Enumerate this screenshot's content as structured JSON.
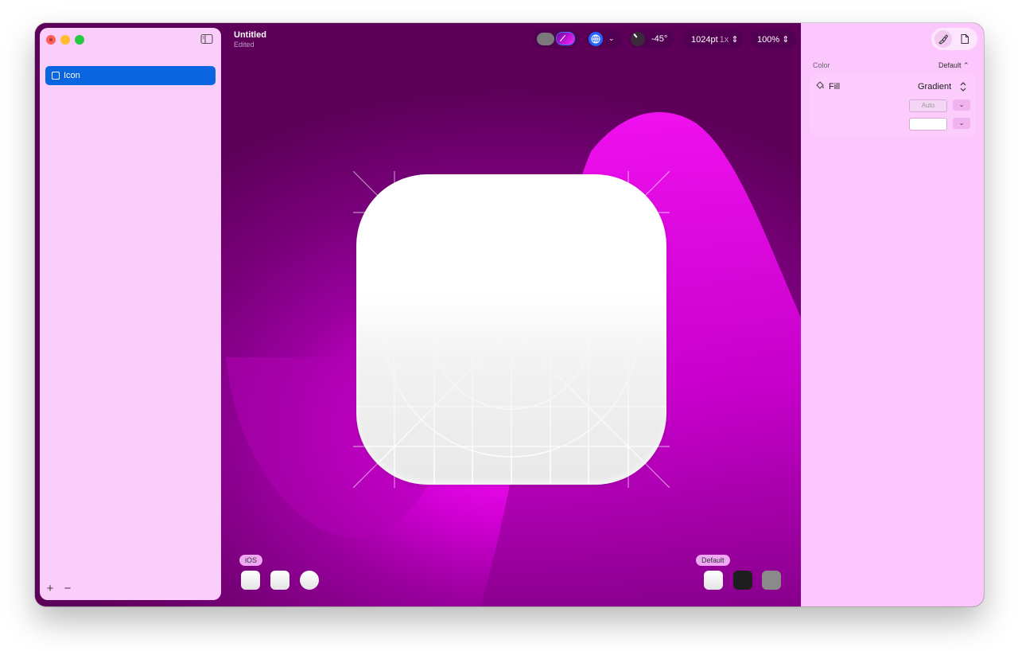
{
  "window": {
    "title": "Untitled",
    "subtitle": "Edited"
  },
  "sidebar": {
    "layers": [
      {
        "label": "Icon",
        "selected": true
      }
    ],
    "add_label": "+",
    "remove_label": "−"
  },
  "toolbar": {
    "angle": "-45°",
    "size": "1024pt",
    "scale": "1x",
    "zoom": "100%"
  },
  "canvas": {
    "platform_tag": "iOS",
    "appearance_tag": "Default"
  },
  "inspector": {
    "color_section": "Color",
    "color_mode": "Default ⌃",
    "fill_label": "Fill",
    "fill_type": "Gradient",
    "auto_label": "Auto"
  },
  "colors": {
    "accent": "#0a66e0",
    "canvas_primary": "#d300d6",
    "sidebar_bg": "#fbcdfb",
    "inspector_bg": "#fcc7fc"
  },
  "icons": [
    "sidebar-toggle-icon",
    "globe-icon",
    "paintbrush-icon",
    "document-icon",
    "paint-bucket-icon",
    "chevron-down-icon",
    "up-down-chevron-icon"
  ]
}
